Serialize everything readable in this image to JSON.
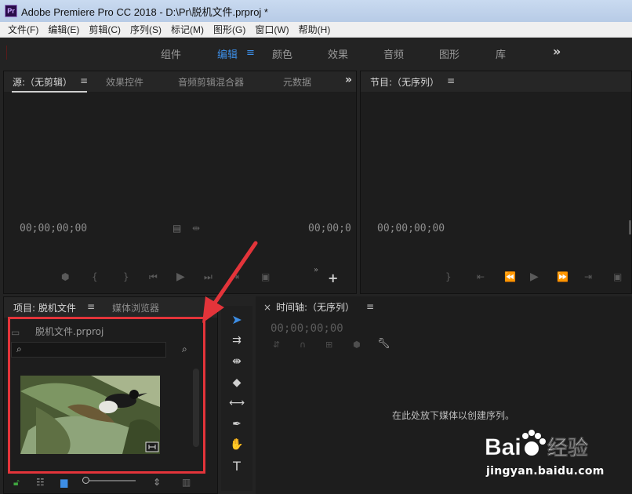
{
  "window": {
    "title": "Adobe Premiere Pro CC 2018 - D:\\Pr\\脱机文件.prproj *",
    "logo": "Pr"
  },
  "menu": [
    "文件(F)",
    "编辑(E)",
    "剪辑(C)",
    "序列(S)",
    "标记(M)",
    "图形(G)",
    "窗口(W)",
    "帮助(H)"
  ],
  "workspaces": {
    "items": [
      "组件",
      "编辑",
      "颜色",
      "效果",
      "音频",
      "图形",
      "库"
    ],
    "active": "编辑",
    "more": "»"
  },
  "source_panel": {
    "tabs": [
      "源:（无剪辑）",
      "效果控件",
      "音频剪辑混合器",
      "元数据"
    ],
    "menu": "≡",
    "more": "»",
    "timecode_left": "00;00;00;00",
    "timecode_right": "00;00;0"
  },
  "program_panel": {
    "tab": "节目:（无序列）",
    "menu": "≡",
    "timecode_left": "00;00;00;00"
  },
  "project_panel": {
    "tabs": [
      "项目: 脱机文件",
      "媒体浏览器"
    ],
    "menu": "≡",
    "more": "»",
    "file_name": "脱机文件.prproj",
    "search_placeholder": ""
  },
  "timeline_panel": {
    "close": "×",
    "tab": "时间轴:（无序列）",
    "menu": "≡",
    "timecode": "00;00;00;00",
    "drop_hint": "在此处放下媒体以创建序列。"
  },
  "tools": [
    "selection-tool",
    "track-select-tool",
    "ripple-edit-tool",
    "razor-tool",
    "slip-tool",
    "pen-tool",
    "hand-tool",
    "type-tool"
  ],
  "watermark": {
    "brand_left": "Bai",
    "brand_right": "经验",
    "url": "jingyan.baidu.com"
  },
  "colors": {
    "accent": "#3d8ee6",
    "highlight": "#e3343a"
  }
}
